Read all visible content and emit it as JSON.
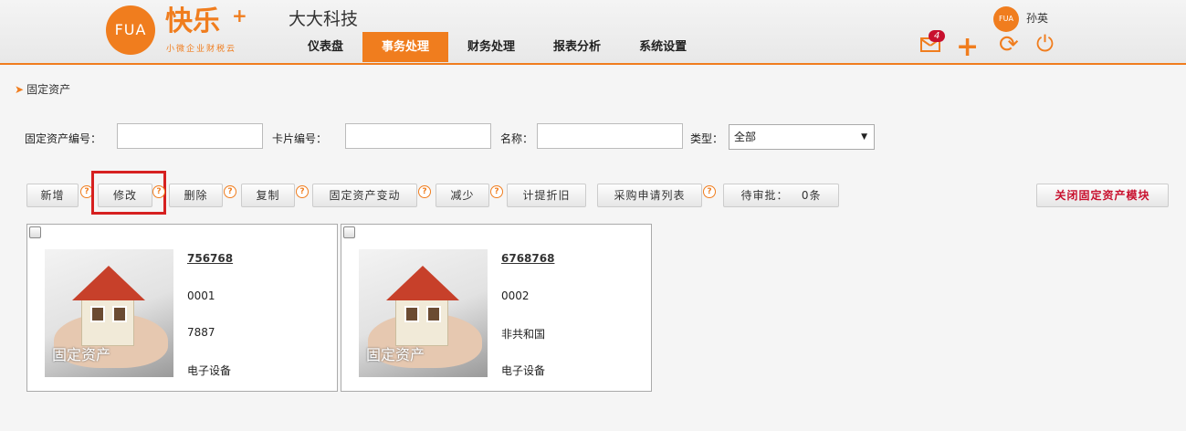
{
  "header": {
    "logo_mark": "FUA",
    "logo_text": "快乐",
    "logo_plus": "+",
    "logo_slogan": "小微企业财税云",
    "company": "大大科技",
    "nav": [
      {
        "label": "仪表盘",
        "active": false
      },
      {
        "label": "事务处理",
        "active": true
      },
      {
        "label": "财务处理",
        "active": false
      },
      {
        "label": "报表分析",
        "active": false
      },
      {
        "label": "系统设置",
        "active": false
      }
    ],
    "message_count": "4",
    "avatar_text": "FUA",
    "username": "孙英"
  },
  "breadcrumb": "固定资产",
  "filters": {
    "asset_no_label": "固定资产编号：",
    "card_no_label": "卡片编号：",
    "name_label": "名称：",
    "type_label": "类型：",
    "type_value": "全部",
    "asset_no_value": "",
    "card_no_value": "",
    "name_value": ""
  },
  "toolbar": {
    "add": "新增",
    "edit": "修改",
    "delete": "删除",
    "copy": "复制",
    "change": "固定资产变动",
    "reduce": "减少",
    "depreciation": "计提折旧",
    "purchase_list": "采购申请列表",
    "pending_label": "待审批：",
    "pending_count": "0条",
    "close_module": "关闭固定资产模块",
    "help_glyph": "?"
  },
  "cards": [
    {
      "code": "756768",
      "card_no": "0001",
      "name": "7887",
      "type": "电子设备",
      "image_text": "固定资产"
    },
    {
      "code": "6768768",
      "card_no": "0002",
      "name": "非共和国",
      "type": "电子设备",
      "image_text": "固定资产"
    }
  ],
  "colors": {
    "accent": "#f07d1e",
    "highlight": "#d62020",
    "danger": "#c8102e"
  }
}
